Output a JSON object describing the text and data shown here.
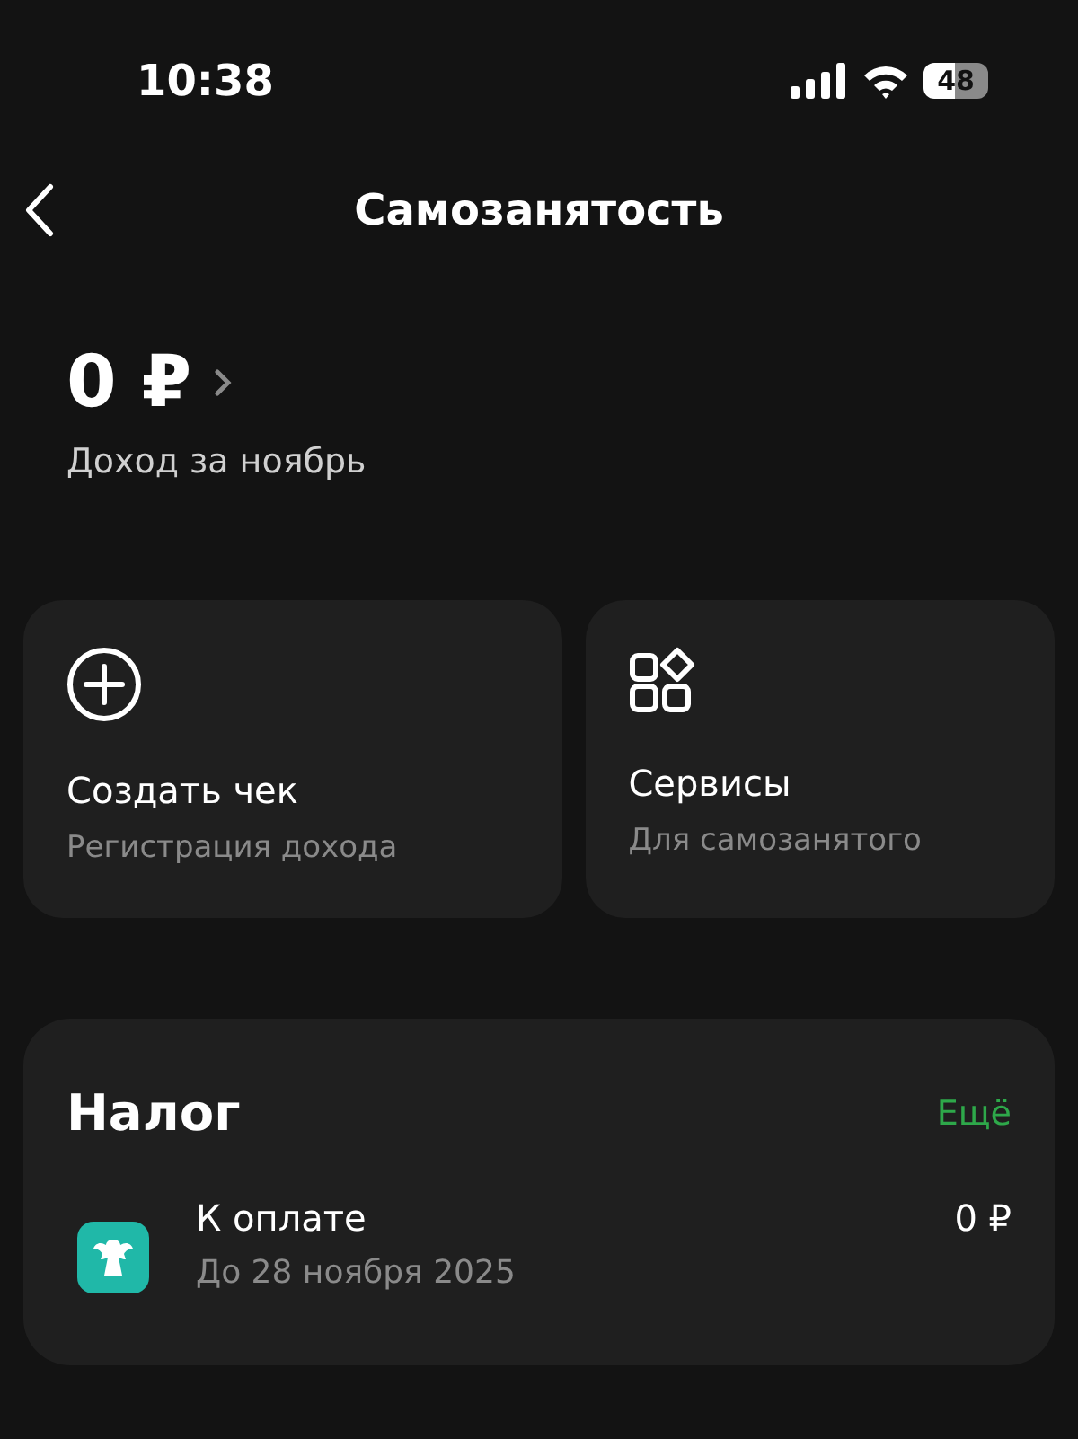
{
  "status_bar": {
    "time": "10:38",
    "battery": "48"
  },
  "nav": {
    "title": "Самозанятость"
  },
  "income": {
    "amount": "0 ₽",
    "label": "Доход за ноябрь"
  },
  "actions": [
    {
      "kind": "create",
      "title": "Создать чек",
      "subtitle": "Регистрация дохода"
    },
    {
      "kind": "services",
      "title": "Сервисы",
      "subtitle": "Для самозанятого"
    }
  ],
  "tax": {
    "title": "Налог",
    "more": "Ещё",
    "items": [
      {
        "title": "К оплате",
        "subtitle": "До 28 ноября 2025",
        "amount": "0 ₽"
      }
    ]
  }
}
